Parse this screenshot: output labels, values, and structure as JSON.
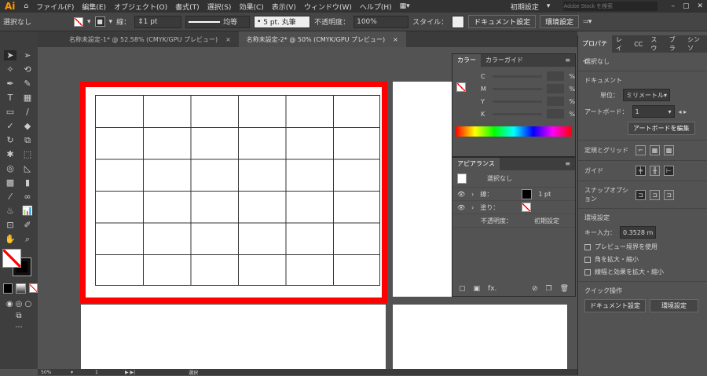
{
  "menubar": {
    "logo": "Ai",
    "items": [
      "ファイル(F)",
      "編集(E)",
      "オブジェクト(O)",
      "書式(T)",
      "選択(S)",
      "効果(C)",
      "表示(V)",
      "ウィンドウ(W)",
      "ヘルプ(H)"
    ],
    "workspace": "初期設定",
    "search_placeholder": "Adobe Stock を検索"
  },
  "control": {
    "selection": "選択なし",
    "stroke_label": "線：",
    "stroke_weight": "1 pt",
    "stroke_profile": "均等",
    "brush": "5 pt. 丸筆",
    "opacity_label": "不透明度：",
    "opacity": "100%",
    "style_label": "スタイル：",
    "doc_setup": "ドキュメント設定",
    "preferences": "環境設定"
  },
  "tabs": [
    {
      "label": "名称未設定-1* @ 52.58% (CMYK/GPU プレビュー)",
      "close": "×"
    },
    {
      "label": "名称未設定-2* @ 50% (CMYK/GPU プレビュー)",
      "close": "×"
    }
  ],
  "status": {
    "zoom": "50%",
    "artboard": "1",
    "mode": "選択"
  },
  "color_panel": {
    "tabs": [
      "カラー",
      "カラーガイド"
    ],
    "channels": [
      "C",
      "M",
      "Y",
      "K"
    ],
    "unit": "%"
  },
  "appearance": {
    "title": "アピアランス",
    "target": "選択なし",
    "stroke_label": "線：",
    "stroke_value": "1 pt",
    "fill_label": "塗り：",
    "opacity_label": "不透明度：",
    "opacity_value": "初期設定",
    "fx": "fx."
  },
  "properties": {
    "tabs": [
      "プロパティ",
      "レイ",
      "CC",
      "スウ",
      "ブラ",
      "シンソ"
    ],
    "selection": "選択なし",
    "document": "ドキュメント",
    "unit_label": "単位：",
    "unit": "ミリメートル",
    "artboard_label": "アートボード：",
    "artboard": "1",
    "edit_artboards": "アートボードを編集",
    "rulers_grids": "定規とグリッド",
    "guides": "ガイド",
    "snap": "スナップオプション",
    "prefs": "環境設定",
    "key_input_label": "キー入力：",
    "key_input": "0.3528 m",
    "checkboxes": [
      "プレビュー境界を使用",
      "角を拡大・縮小",
      "線幅と効果を拡大・縮小"
    ],
    "quick_actions": "クイック操作",
    "doc_setup": "ドキュメント設定",
    "preferences": "環境設定"
  },
  "colors": {
    "accent_red": "#ff0000",
    "ui_dark": "#323232",
    "panel": "#535353"
  }
}
